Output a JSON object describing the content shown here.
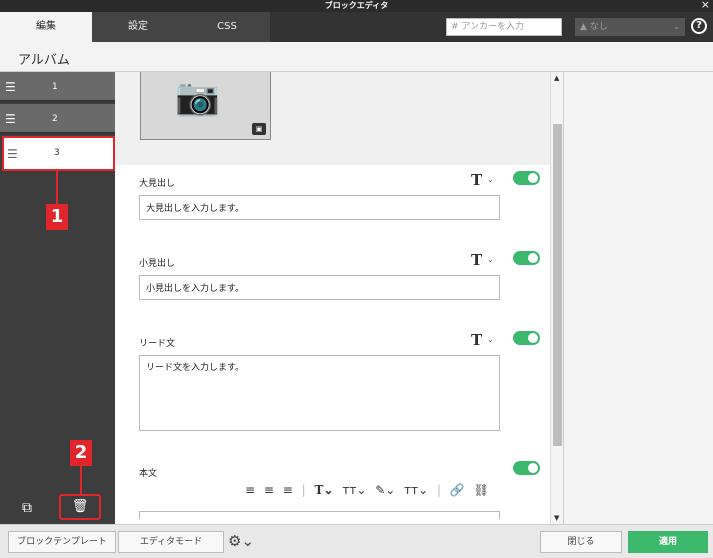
{
  "window": {
    "title": "ブロックエディタ",
    "close": "×"
  },
  "tabs": [
    {
      "label": "編集"
    },
    {
      "label": "設定"
    },
    {
      "label": "CSS"
    }
  ],
  "anchor": {
    "placeholder": "# アンカーを入力"
  },
  "style_select": {
    "value": "なし",
    "icon": "▲"
  },
  "help": {
    "label": "?"
  },
  "page": {
    "title": "アルバム"
  },
  "sidebar": {
    "items": [
      {
        "label": "1"
      },
      {
        "label": "2"
      },
      {
        "label": "3"
      }
    ],
    "callouts": [
      "1",
      "2"
    ]
  },
  "sections": {
    "heading_large": {
      "label": "大見出し",
      "value": "大見出しを入力します。"
    },
    "heading_small": {
      "label": "小見出し",
      "value": "小見出しを入力します。"
    },
    "lead": {
      "label": "リード文",
      "value": "リード文を入力します。"
    },
    "body": {
      "label": "本文"
    }
  },
  "text_button": "T",
  "footer": {
    "block_template": "ブロックテンプレート",
    "editor_mode": "エディタモード",
    "close": "閉じる",
    "apply": "適用"
  },
  "colors": {
    "accent_green": "#3bb86c",
    "callout_red": "#e0262b",
    "dark": "#333333"
  }
}
